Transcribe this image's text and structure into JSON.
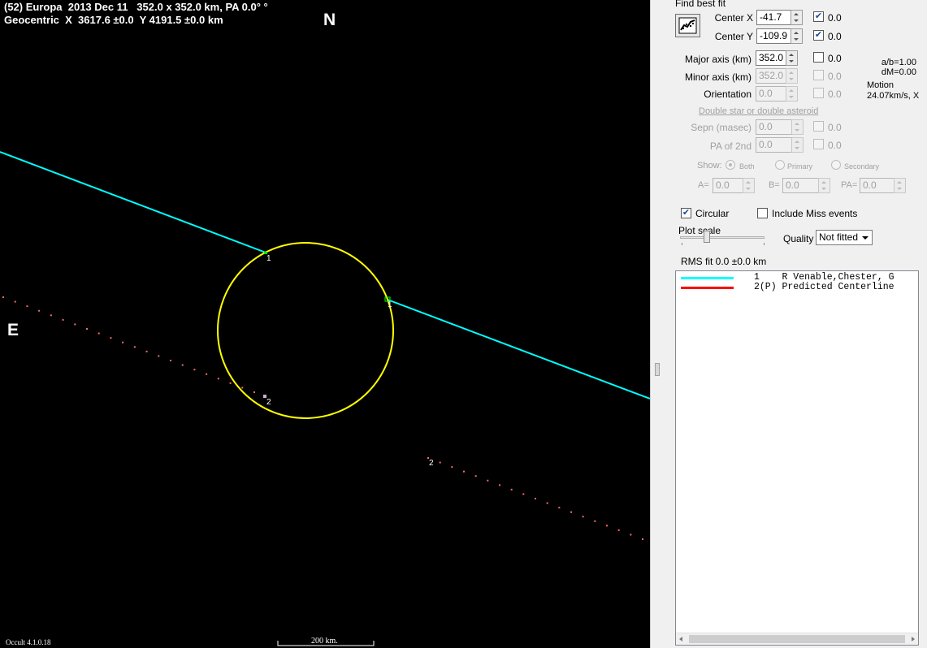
{
  "plot": {
    "title_line1": "(52) Europa  2013 Dec 11   352.0 x 352.0 km, PA 0.0° °",
    "title_line2": "Geocentric  X  3617.6 ±0.0  Y 4191.5 ±0.0 km",
    "north": "N",
    "east": "E",
    "chord_labels": [
      "1",
      "1",
      "2",
      "2"
    ],
    "version": "Occult 4.1.0.18",
    "scale_label": "200 km.",
    "colors": {
      "background": "#000000",
      "chord1": "#00ffff",
      "ellipse": "#ffff00",
      "predicted": "#ff6a6a",
      "label": "#ffffff"
    }
  },
  "panel": {
    "find_best_fit": "Find best fit",
    "fit_icon": "chart-fit-icon",
    "center_x": {
      "label": "Center X",
      "value": "-41.7",
      "fit_checked": true,
      "unc": "0.0"
    },
    "center_y": {
      "label": "Center Y",
      "value": "-109.9",
      "fit_checked": true,
      "unc": "0.0"
    },
    "major_axis": {
      "label": "Major axis (km)",
      "value": "352.0",
      "fit_checked": false,
      "unc": "0.0"
    },
    "minor_axis": {
      "label": "Minor axis (km)",
      "value": "352.0",
      "unc": "0.0"
    },
    "orientation": {
      "label": "Orientation",
      "value": "0.0",
      "unc": "0.0"
    },
    "ab_ratio": "a/b=1.00",
    "dm": "dM=0.00",
    "motion_label": "Motion",
    "motion_value": "24.07km/s, X",
    "double_star_link": "Double star  or  double asteroid",
    "sepn": {
      "label": "Sepn (masec)",
      "value": "0.0",
      "unc": "0.0"
    },
    "pa2nd": {
      "label": "PA of 2nd",
      "value": "0.0",
      "unc": "0.0"
    },
    "show": {
      "label": "Show:",
      "options": [
        "Both",
        "Primary",
        "Secondary"
      ],
      "selected": "Both"
    },
    "a_field": {
      "label": "A=",
      "value": "0.0"
    },
    "b_field": {
      "label": "B=",
      "value": "0.0"
    },
    "pa_field": {
      "label": "PA=",
      "value": "0.0"
    },
    "circular": {
      "label": "Circular",
      "checked": true
    },
    "include_miss": {
      "label": "Include Miss events",
      "checked": false
    },
    "plot_scale": "Plot scale",
    "quality": {
      "label": "Quality",
      "value": "Not fitted"
    },
    "rms_fit": "RMS fit 0.0 ±0.0 km",
    "list": [
      {
        "color": "#00ffff",
        "text": "1    R Venable,Chester, G"
      },
      {
        "color": "#ff0000",
        "text": "2(P) Predicted Centerline"
      }
    ]
  }
}
